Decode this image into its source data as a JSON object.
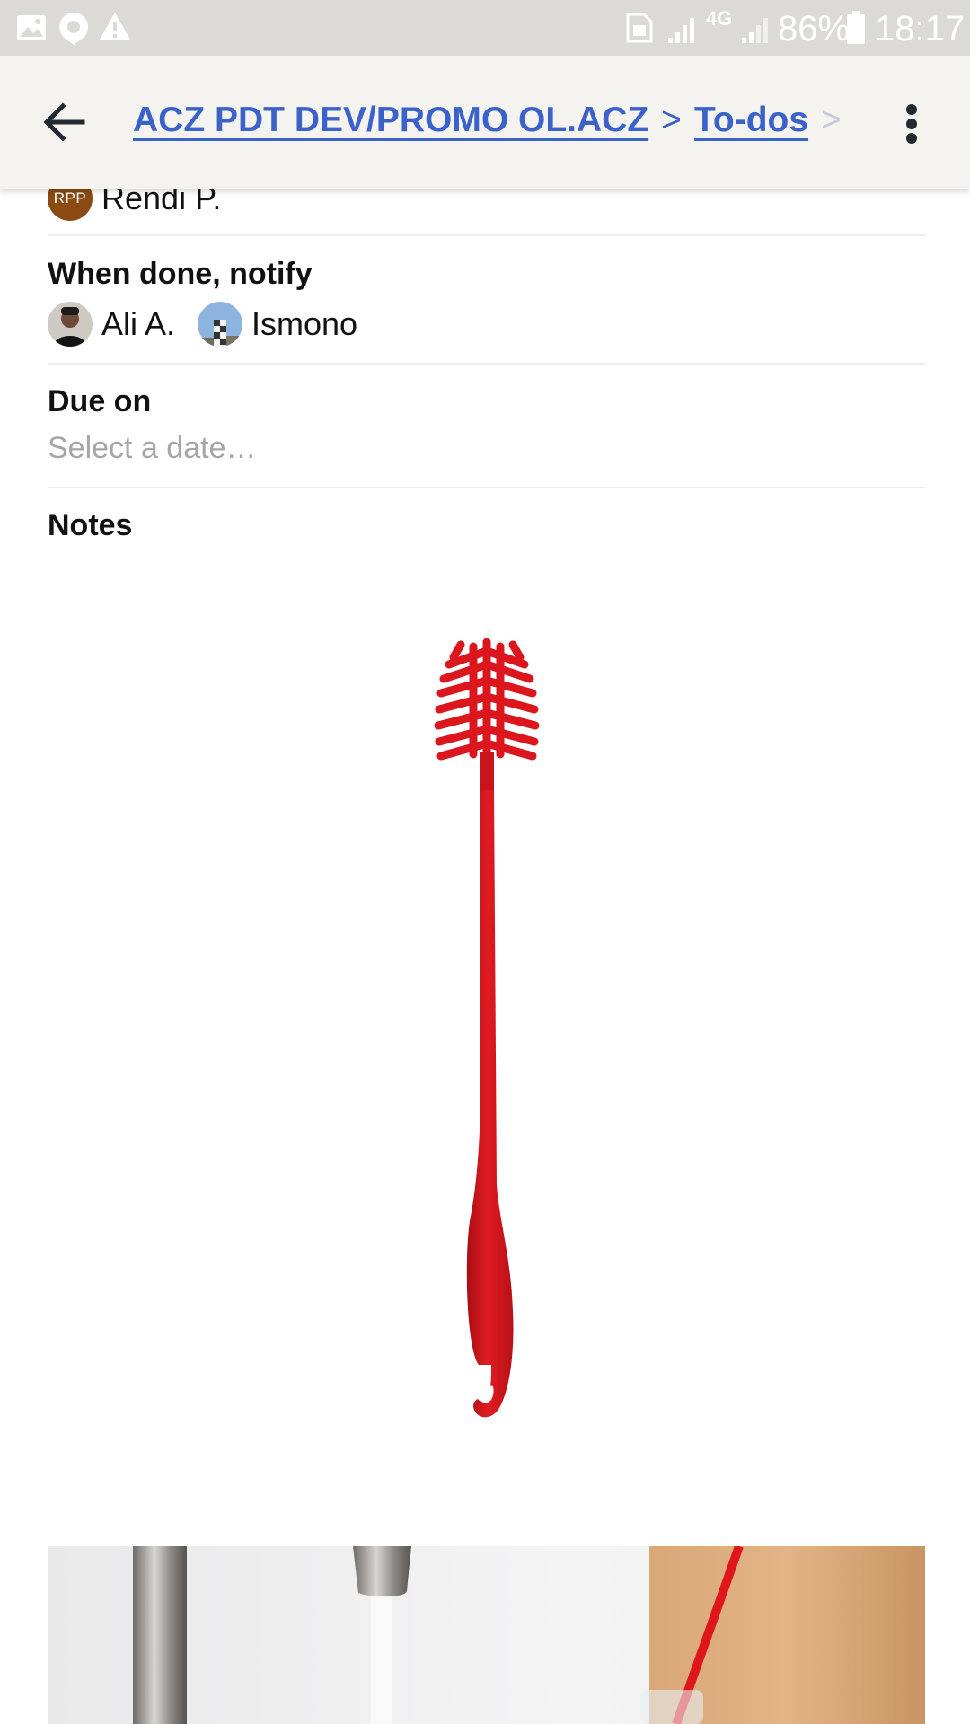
{
  "status_bar": {
    "battery": "86%",
    "time": "18:17",
    "network": "4G",
    "icons": [
      "image-icon",
      "location-icon",
      "warning-icon",
      "sim-icon",
      "signal-icon",
      "battery-icon"
    ]
  },
  "app_bar": {
    "back_icon": "arrow-left-icon",
    "breadcrumb": {
      "project": "ACZ PDT DEV/PROMO OL.ACZ",
      "separator": ">",
      "section": "To-dos",
      "trailing_separator": ">"
    },
    "more_icon": "more-vertical-icon"
  },
  "assignee": {
    "avatar_initials": "RPP",
    "avatar_color": "#8a4b12",
    "name": "Rendi P."
  },
  "notify": {
    "title": "When done, notify",
    "people": [
      {
        "name": "Ali A."
      },
      {
        "name": "Ismono"
      }
    ]
  },
  "due": {
    "title": "Due on",
    "placeholder": "Select a date…"
  },
  "notes": {
    "title": "Notes",
    "images": [
      "red-bottle-brush-image",
      "bottle-brush-in-sink-photo"
    ]
  },
  "colors": {
    "link": "#3a62c9",
    "brush_red": "#d8141b",
    "appbar_bg": "#f5f3f0",
    "statusbar_bg": "#dcdad6"
  }
}
